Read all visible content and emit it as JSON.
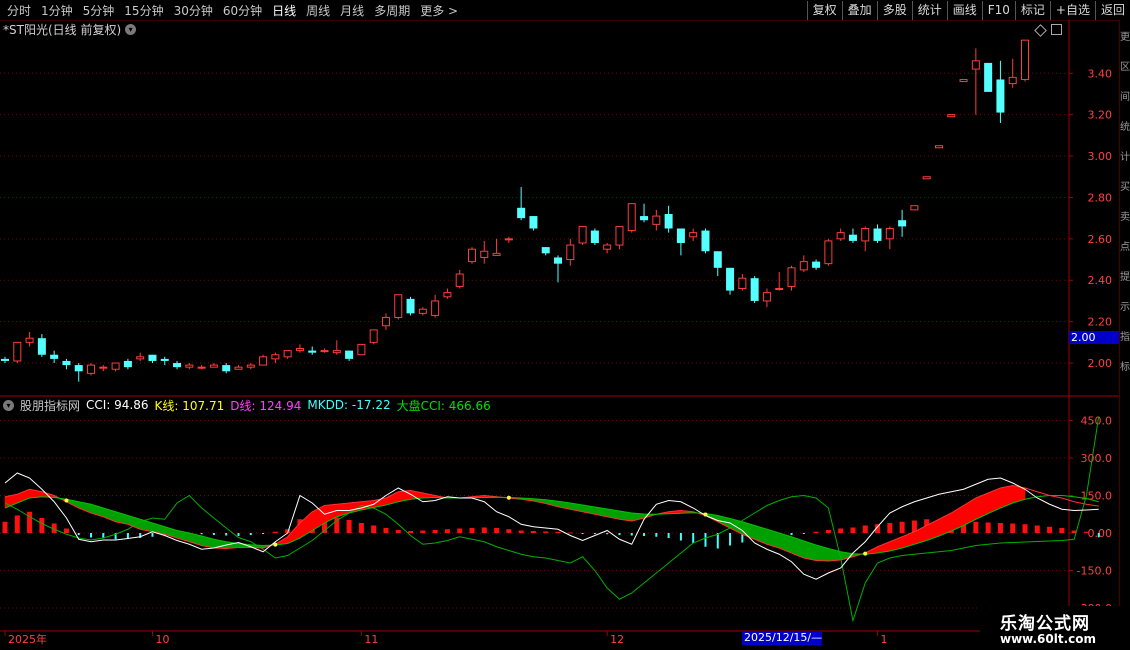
{
  "toolbar": {
    "periods": [
      "分时",
      "1分钟",
      "5分钟",
      "15分钟",
      "30分钟",
      "60分钟",
      "日线",
      "周线",
      "月线",
      "多周期",
      "更多"
    ],
    "active_period": "日线",
    "more_arrow": ">",
    "buttons": [
      "复权",
      "叠加",
      "多股",
      "统计",
      "画线",
      "F10",
      "标记",
      "+自选",
      "返回"
    ]
  },
  "stock_title": "*ST阳光(日线 前复权)",
  "indicator": {
    "name": "股朋指标网",
    "cci_label": "CCI: 94.86",
    "k_label": "K线: 107.71",
    "d_label": "D线: 124.94",
    "mkdd_label": "MKDD: -17.22",
    "market_label": "大盘CCI: 466.66",
    "colors": {
      "cci": "#ffffff",
      "k": "#ffff00",
      "d": "#ff40ff",
      "mkdd": "#40ffff",
      "market": "#00e000"
    }
  },
  "price_badge": "2.00",
  "date_badge": "2025/12/15/—",
  "watermark": {
    "line1": "乐淘公式网",
    "line2": "www.60lt.com"
  },
  "side_glyphs": [
    "更",
    "区",
    "间",
    "统",
    "计",
    "买",
    "卖",
    "点",
    "提",
    "示",
    "指",
    "标"
  ],
  "colors": {
    "up": "#ff3c3c",
    "down": "#54ffff",
    "grid": "#7a0000",
    "axis_text": "#ff4040",
    "red_fill": "#ff0000",
    "green_fill": "#00a000"
  },
  "chart_data": [
    {
      "type": "candlestick",
      "title": "*ST阳光(日线 前复权)",
      "ylim": [
        1.86,
        3.58
      ],
      "yticks": [
        2.0,
        2.2,
        2.4,
        2.6,
        2.8,
        3.0,
        3.2,
        3.4
      ],
      "ytick_labels": [
        "2.00",
        "2.20",
        "2.40",
        "2.60",
        "2.80",
        "3.00",
        "3.20",
        "3.40"
      ],
      "x_labels": [
        {
          "label": "2025年",
          "index": 0
        },
        {
          "label": "10",
          "index": 12
        },
        {
          "label": "11",
          "index": 29
        },
        {
          "label": "12",
          "index": 49
        },
        {
          "label": "1",
          "index": 71
        }
      ],
      "candles": [
        [
          2.02,
          2.01,
          2.03,
          2.0
        ],
        [
          2.01,
          2.1,
          2.1,
          2.0
        ],
        [
          2.1,
          2.12,
          2.15,
          2.08
        ],
        [
          2.12,
          2.04,
          2.14,
          2.03
        ],
        [
          2.04,
          2.02,
          2.06,
          2.0
        ],
        [
          2.01,
          1.99,
          2.02,
          1.97
        ],
        [
          1.99,
          1.96,
          2.0,
          1.91
        ],
        [
          1.95,
          1.99,
          2.0,
          1.94
        ],
        [
          1.98,
          1.98,
          1.99,
          1.96
        ],
        [
          1.97,
          2.0,
          2.0,
          1.96
        ],
        [
          2.01,
          1.98,
          2.02,
          1.97
        ],
        [
          2.02,
          2.03,
          2.05,
          2.01
        ],
        [
          2.04,
          2.01,
          2.04,
          2.0
        ],
        [
          2.02,
          2.01,
          2.03,
          1.99
        ],
        [
          2.0,
          1.98,
          2.01,
          1.97
        ],
        [
          1.98,
          1.99,
          2.0,
          1.97
        ],
        [
          1.98,
          1.98,
          1.99,
          1.97
        ],
        [
          1.98,
          1.99,
          2.0,
          1.98
        ],
        [
          1.99,
          1.96,
          2.0,
          1.95
        ],
        [
          1.97,
          1.98,
          1.99,
          1.97
        ],
        [
          1.98,
          1.99,
          2.0,
          1.97
        ],
        [
          1.99,
          2.03,
          2.04,
          1.99
        ],
        [
          2.02,
          2.04,
          2.05,
          2.0
        ],
        [
          2.03,
          2.06,
          2.06,
          2.02
        ],
        [
          2.06,
          2.07,
          2.09,
          2.05
        ],
        [
          2.06,
          2.05,
          2.08,
          2.04
        ],
        [
          2.06,
          2.06,
          2.07,
          2.05
        ],
        [
          2.05,
          2.06,
          2.11,
          2.04
        ],
        [
          2.06,
          2.02,
          2.06,
          2.01
        ],
        [
          2.04,
          2.09,
          2.09,
          2.04
        ],
        [
          2.1,
          2.16,
          2.16,
          2.09
        ],
        [
          2.18,
          2.22,
          2.24,
          2.16
        ],
        [
          2.22,
          2.33,
          2.33,
          2.21
        ],
        [
          2.31,
          2.24,
          2.32,
          2.23
        ],
        [
          2.24,
          2.26,
          2.27,
          2.23
        ],
        [
          2.23,
          2.3,
          2.33,
          2.22
        ],
        [
          2.32,
          2.34,
          2.36,
          2.31
        ],
        [
          2.37,
          2.43,
          2.45,
          2.36
        ],
        [
          2.49,
          2.55,
          2.56,
          2.48
        ],
        [
          2.51,
          2.54,
          2.59,
          2.48
        ],
        [
          2.52,
          2.53,
          2.6,
          2.52
        ],
        [
          2.6,
          2.6,
          2.61,
          2.58
        ],
        [
          2.75,
          2.7,
          2.85,
          2.69
        ],
        [
          2.71,
          2.65,
          2.71,
          2.64
        ],
        [
          2.56,
          2.53,
          2.56,
          2.52
        ],
        [
          2.51,
          2.48,
          2.52,
          2.39
        ],
        [
          2.5,
          2.57,
          2.6,
          2.47
        ],
        [
          2.58,
          2.66,
          2.66,
          2.57
        ],
        [
          2.64,
          2.58,
          2.65,
          2.57
        ],
        [
          2.55,
          2.57,
          2.58,
          2.53
        ],
        [
          2.57,
          2.66,
          2.66,
          2.55
        ],
        [
          2.64,
          2.77,
          2.77,
          2.63
        ],
        [
          2.71,
          2.69,
          2.77,
          2.68
        ],
        [
          2.67,
          2.71,
          2.74,
          2.64
        ],
        [
          2.72,
          2.65,
          2.76,
          2.63
        ],
        [
          2.65,
          2.58,
          2.65,
          2.52
        ],
        [
          2.61,
          2.63,
          2.65,
          2.59
        ],
        [
          2.64,
          2.54,
          2.65,
          2.53
        ],
        [
          2.54,
          2.46,
          2.54,
          2.42
        ],
        [
          2.46,
          2.35,
          2.46,
          2.33
        ],
        [
          2.36,
          2.41,
          2.43,
          2.35
        ],
        [
          2.41,
          2.3,
          2.42,
          2.29
        ],
        [
          2.3,
          2.34,
          2.36,
          2.27
        ],
        [
          2.36,
          2.36,
          2.44,
          2.35
        ],
        [
          2.37,
          2.46,
          2.47,
          2.35
        ],
        [
          2.45,
          2.49,
          2.52,
          2.44
        ],
        [
          2.49,
          2.46,
          2.5,
          2.45
        ],
        [
          2.48,
          2.59,
          2.6,
          2.47
        ],
        [
          2.6,
          2.63,
          2.65,
          2.59
        ],
        [
          2.62,
          2.59,
          2.65,
          2.58
        ],
        [
          2.59,
          2.65,
          2.66,
          2.54
        ],
        [
          2.65,
          2.59,
          2.67,
          2.58
        ],
        [
          2.6,
          2.65,
          2.66,
          2.55
        ],
        [
          2.69,
          2.66,
          2.74,
          2.61
        ],
        [
          2.74,
          2.76,
          2.76,
          2.74
        ],
        [
          2.89,
          2.9,
          2.9,
          2.89
        ],
        [
          3.04,
          3.05,
          3.05,
          3.04
        ],
        [
          3.19,
          3.2,
          3.2,
          3.19
        ],
        [
          3.36,
          3.37,
          3.37,
          3.36
        ],
        [
          3.42,
          3.46,
          3.52,
          3.2
        ],
        [
          3.45,
          3.31,
          3.45,
          3.31
        ],
        [
          3.37,
          3.21,
          3.46,
          3.16
        ],
        [
          3.35,
          3.38,
          3.47,
          3.33
        ],
        [
          3.37,
          3.56,
          3.56,
          3.36
        ]
      ]
    },
    {
      "type": "line",
      "title": "股朋指标网",
      "ylim": [
        -380,
        480
      ],
      "yticks": [
        -300,
        -150,
        0,
        150,
        300,
        450
      ],
      "ytick_labels": [
        "-300.0",
        "-150.0",
        "0.00",
        "150.0",
        "300.0",
        "450.0"
      ],
      "series": [
        {
          "name": "CCI",
          "values": [
            200,
            240,
            220,
            175,
            125,
            60,
            -25,
            -35,
            -28,
            -28,
            -22,
            -15,
            5,
            -10,
            -30,
            -45,
            -65,
            -60,
            -48,
            -38,
            -55,
            -75,
            -35,
            0,
            150,
            120,
            75,
            90,
            90,
            100,
            115,
            150,
            180,
            155,
            125,
            130,
            145,
            140,
            140,
            125,
            85,
            65,
            35,
            25,
            20,
            15,
            -10,
            -30,
            -10,
            10,
            -25,
            -45,
            55,
            115,
            130,
            125,
            100,
            70,
            50,
            40,
            10,
            -40,
            -65,
            -85,
            -115,
            -165,
            -185,
            -160,
            -140,
            -80,
            -35,
            25,
            80,
            105,
            125,
            140,
            155,
            165,
            175,
            195,
            215,
            220,
            200,
            175,
            140,
            115,
            95,
            90,
            92,
            94.86
          ]
        },
        {
          "name": "K线",
          "values": [
            145,
            155,
            175,
            165,
            150,
            125,
            100,
            80,
            65,
            45,
            35,
            15,
            5,
            -5,
            -20,
            -35,
            -50,
            -60,
            -62,
            -58,
            -58,
            -60,
            -45,
            -15,
            40,
            85,
            110,
            115,
            120,
            125,
            130,
            140,
            165,
            170,
            160,
            150,
            140,
            140,
            145,
            150,
            145,
            140,
            135,
            128,
            118,
            105,
            95,
            85,
            75,
            65,
            55,
            48,
            60,
            75,
            85,
            90,
            85,
            70,
            45,
            20,
            -5,
            -25,
            -45,
            -60,
            -80,
            -100,
            -110,
            -112,
            -108,
            -95,
            -80,
            -55,
            -35,
            -15,
            5,
            30,
            55,
            80,
            110,
            140,
            160,
            180,
            190,
            180,
            165,
            150,
            140,
            125,
            115,
            107.71
          ]
        },
        {
          "name": "D线",
          "values": [
            100,
            120,
            140,
            145,
            142,
            135,
            125,
            115,
            100,
            85,
            70,
            55,
            40,
            25,
            10,
            0,
            -12,
            -25,
            -35,
            -42,
            -47,
            -50,
            -48,
            -42,
            -20,
            10,
            40,
            65,
            80,
            92,
            102,
            112,
            125,
            135,
            140,
            142,
            140,
            140,
            141,
            142,
            143,
            142,
            140,
            137,
            133,
            127,
            120,
            112,
            104,
            96,
            88,
            80,
            76,
            75,
            77,
            79,
            81,
            78,
            70,
            58,
            45,
            30,
            15,
            0,
            -15,
            -32,
            -48,
            -62,
            -75,
            -83,
            -85,
            -80,
            -72,
            -60,
            -45,
            -30,
            -12,
            8,
            30,
            55,
            78,
            100,
            120,
            135,
            145,
            150,
            150,
            145,
            138,
            124.94
          ]
        },
        {
          "name": "大盘CCI",
          "values": [
            120,
            95,
            65,
            38,
            15,
            -5,
            -20,
            -28,
            -20,
            -5,
            15,
            45,
            60,
            55,
            120,
            150,
            100,
            60,
            20,
            -18,
            -35,
            -65,
            -100,
            -90,
            -60,
            -30,
            10,
            50,
            80,
            110,
            100,
            75,
            35,
            -10,
            -45,
            -40,
            -30,
            -15,
            -25,
            -35,
            -55,
            -70,
            -85,
            -95,
            -100,
            -110,
            -120,
            -95,
            -150,
            -220,
            -265,
            -240,
            -200,
            -160,
            -120,
            -80,
            -40,
            -20,
            -5,
            20,
            50,
            80,
            110,
            130,
            145,
            150,
            140,
            100,
            -100,
            -350,
            -200,
            -120,
            -100,
            -90,
            -85,
            -80,
            -75,
            -70,
            -60,
            -50,
            -45,
            -40,
            -38,
            -36,
            -34,
            -32,
            -30,
            -25,
            150,
            466.66
          ]
        }
      ],
      "bars": {
        "name": "MKDD",
        "values": [
          45,
          70,
          85,
          60,
          38,
          18,
          -8,
          -18,
          -22,
          -25,
          -24,
          -20,
          -15,
          -12,
          -8,
          -6,
          -5,
          -8,
          -10,
          -12,
          -8,
          -4,
          5,
          15,
          55,
          70,
          75,
          62,
          52,
          40,
          30,
          20,
          12,
          8,
          10,
          12,
          15,
          18,
          20,
          22,
          20,
          15,
          10,
          8,
          6,
          5,
          2,
          -2,
          -4,
          -5,
          -8,
          -10,
          -12,
          -15,
          -20,
          -30,
          -40,
          -55,
          -62,
          -50,
          -38,
          -22,
          -18,
          -15,
          -8,
          -3,
          5,
          12,
          18,
          22,
          30,
          35,
          40,
          45,
          50,
          55,
          52,
          50,
          48,
          45,
          42,
          40,
          38,
          35,
          30,
          25,
          20,
          10,
          5,
          -17.22
        ]
      }
    }
  ]
}
